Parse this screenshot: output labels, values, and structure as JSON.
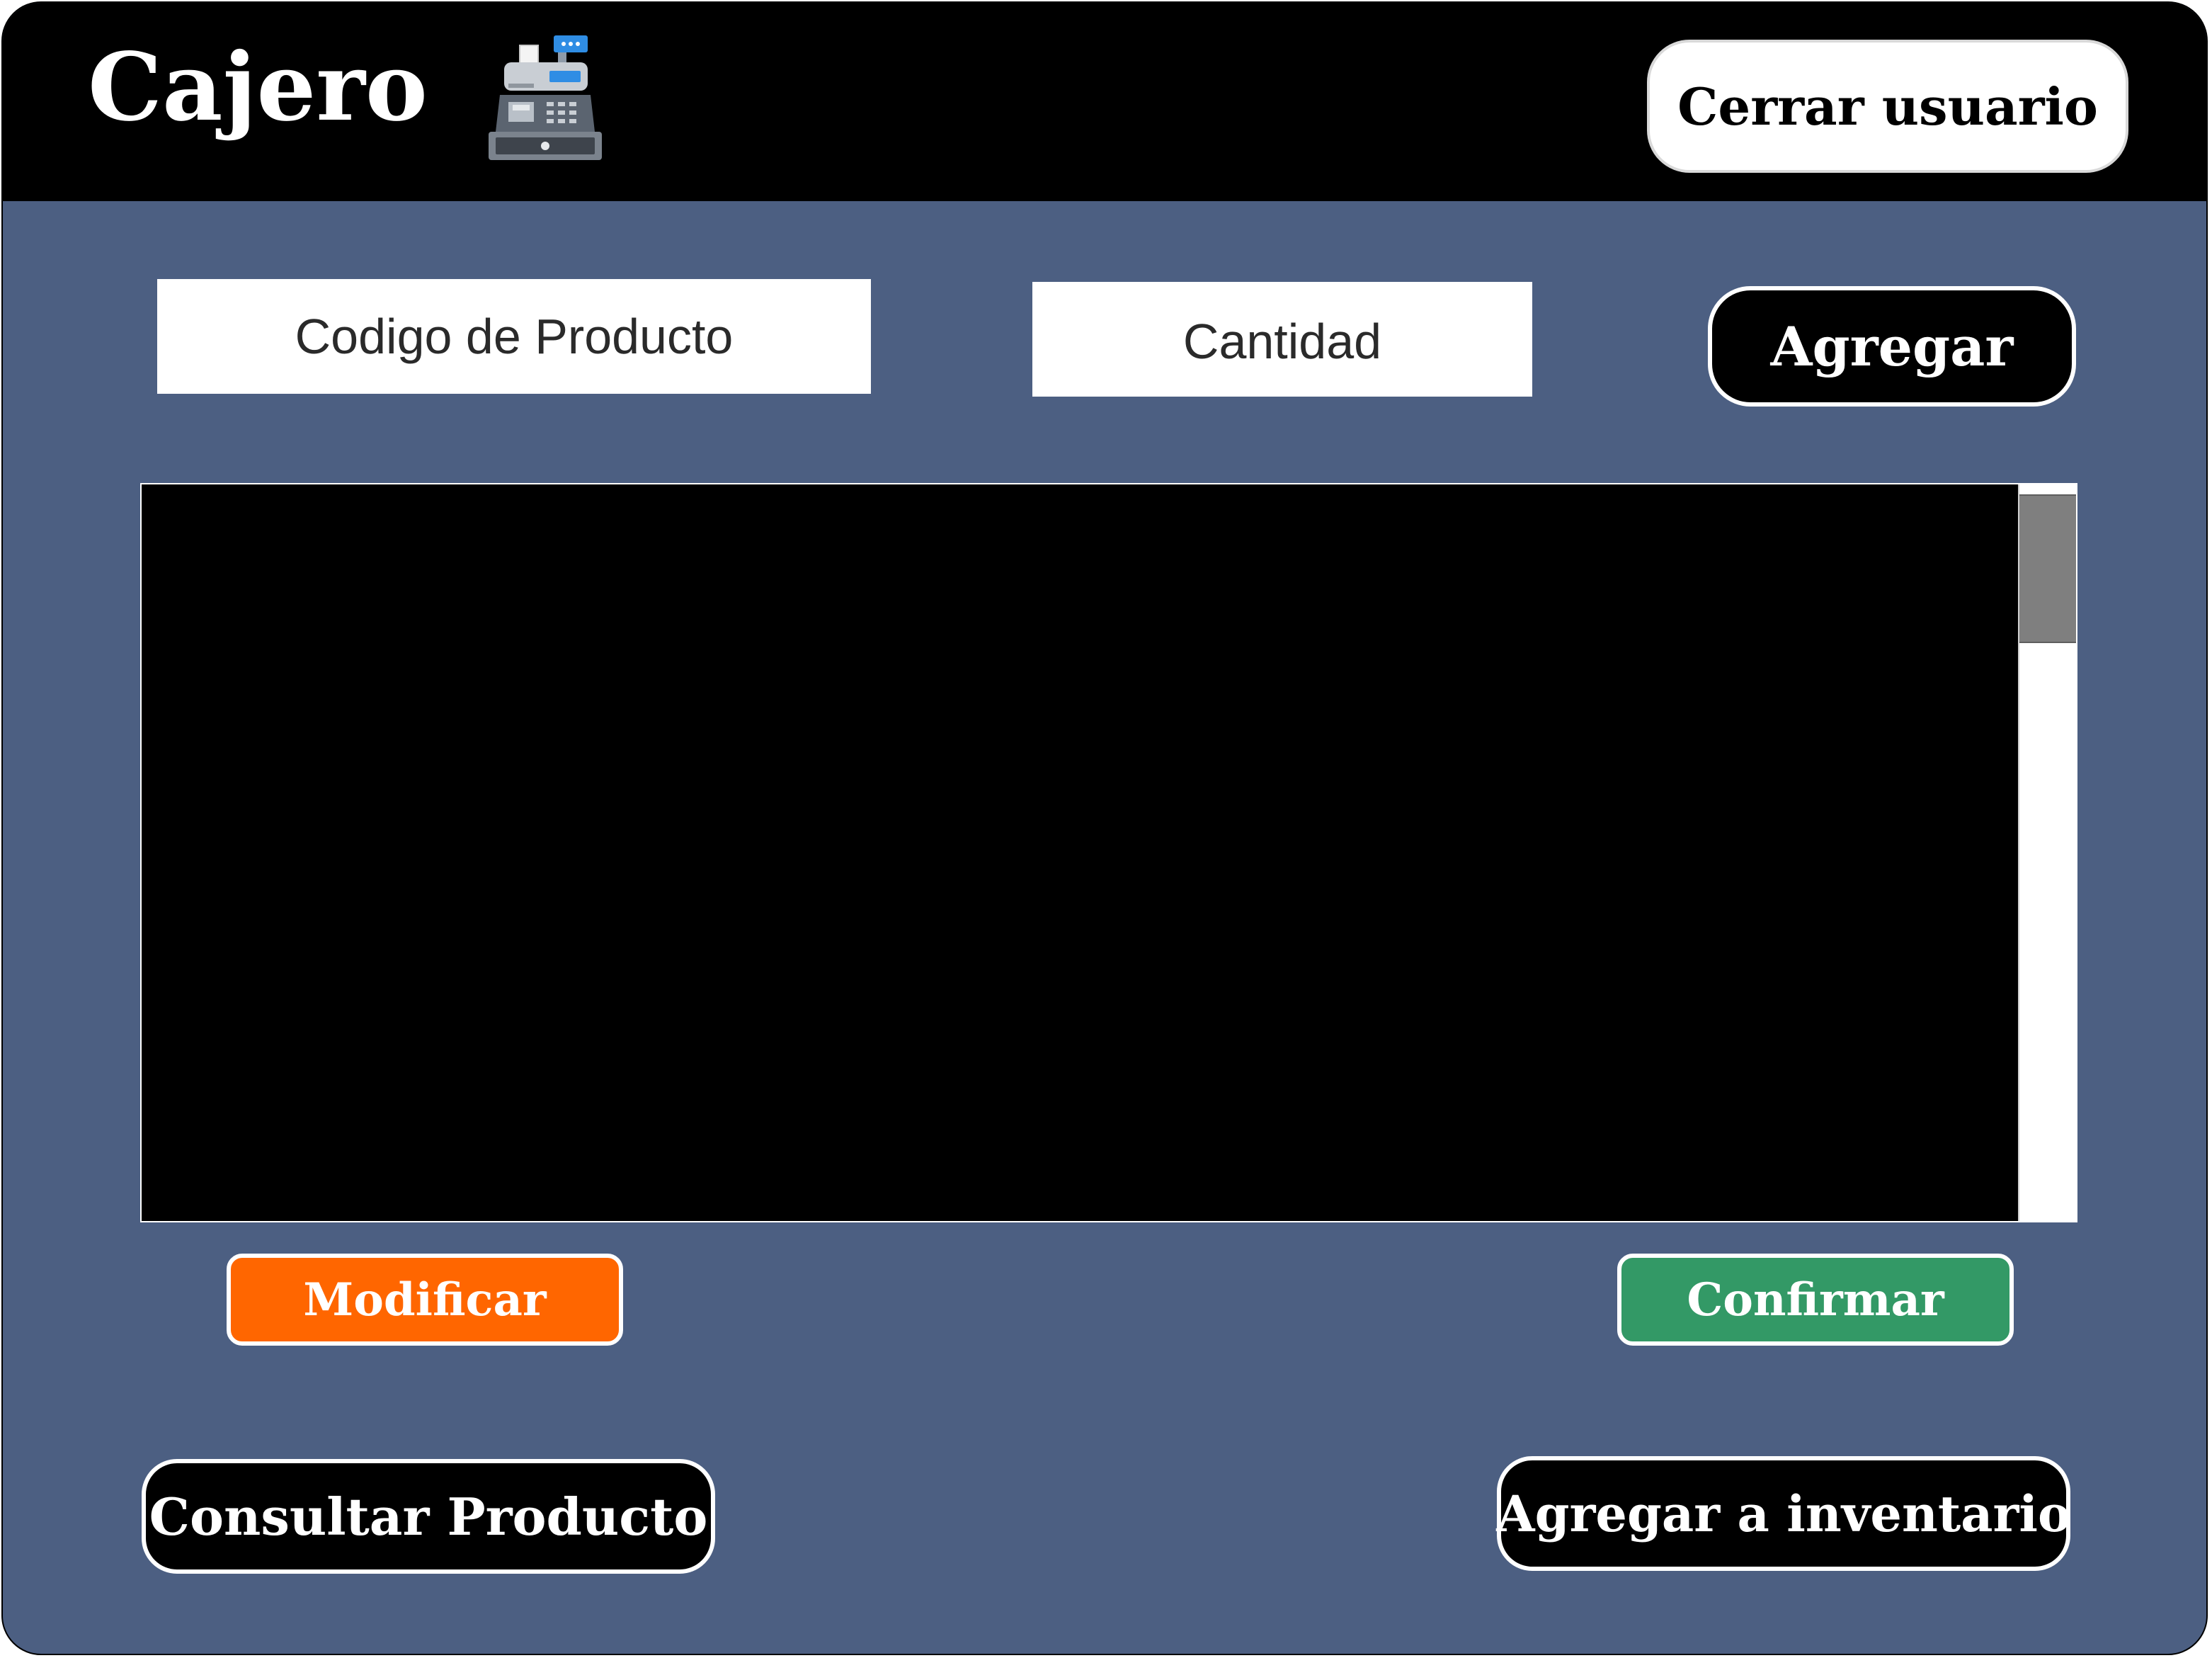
{
  "header": {
    "title": "Cajero",
    "icon": "cash-register-icon",
    "logout_label": "Cerrar usuario"
  },
  "form": {
    "code_placeholder": "Codigo de Producto",
    "code_value": "",
    "quantity_placeholder": "Cantidad",
    "quantity_value": "",
    "add_label": "Agregar"
  },
  "product_list": {
    "items": []
  },
  "actions": {
    "modify_label": "Modificar",
    "confirm_label": "Confirmar",
    "query_label": "Consultar Producto",
    "inventory_label": "Agregar a inventario"
  },
  "colors": {
    "background": "#4c5f82",
    "header": "#000000",
    "modify": "#ff6600",
    "confirm": "#339966"
  }
}
